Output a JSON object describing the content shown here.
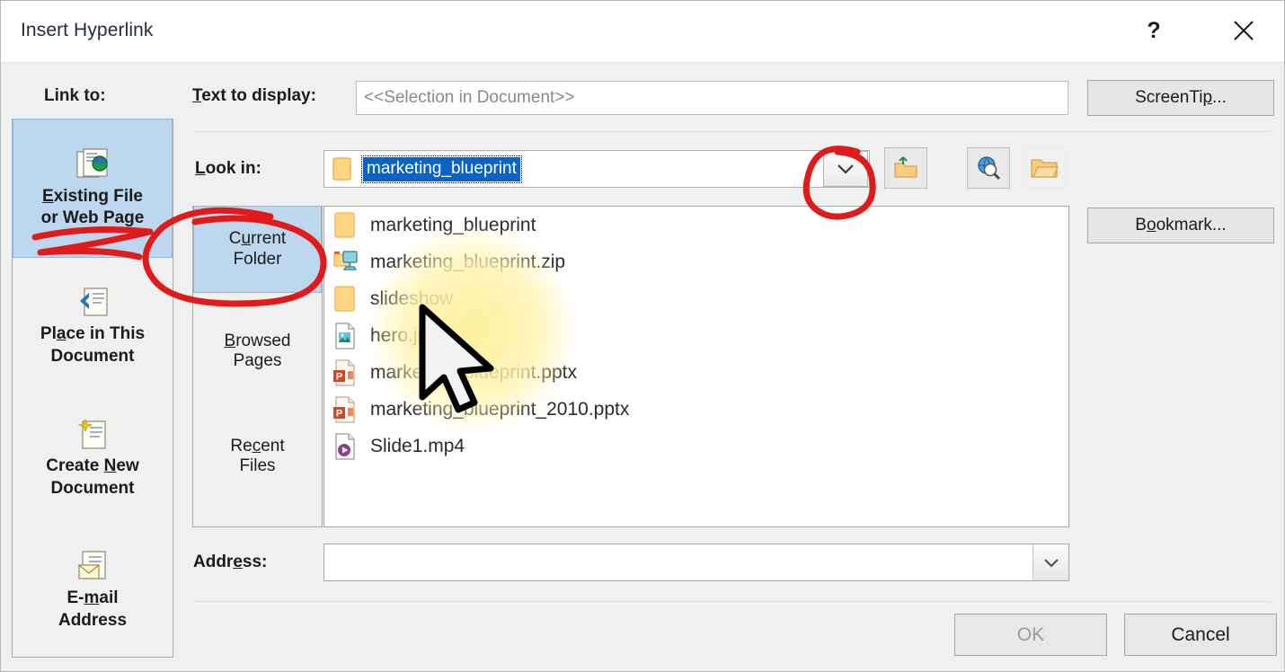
{
  "window": {
    "title": "Insert Hyperlink",
    "help_label": "?",
    "close_label": "✕"
  },
  "link_to": {
    "label": "Link to:",
    "items": [
      {
        "id": "existing-file-or-web-page",
        "line1": "Existing File",
        "line2": "or Web Page",
        "icon": "existing-file-icon",
        "selected": true
      },
      {
        "id": "place-in-this-document",
        "line1": "Place in This",
        "line2": "Document",
        "icon": "place-in-document-icon",
        "selected": false
      },
      {
        "id": "create-new-document",
        "line1": "Create New",
        "line2": "Document",
        "icon": "create-new-document-icon",
        "selected": false
      },
      {
        "id": "email-address",
        "line1": "E-mail",
        "line2": "Address",
        "icon": "email-address-icon",
        "selected": false
      }
    ]
  },
  "text_to_display": {
    "label": "Text to display:",
    "value": "<<Selection in Document>>",
    "placeholder": "<<Selection in Document>>"
  },
  "look_in": {
    "label": "Look in:",
    "value": "marketing_blueprint",
    "folder_icon": "folder-icon",
    "dropdown_icon": "chevron-down-icon",
    "tools": [
      {
        "id": "up-one-folder",
        "icon": "up-one-folder-icon"
      },
      {
        "id": "browse-the-web",
        "icon": "browse-web-icon"
      },
      {
        "id": "browse-for-file",
        "icon": "browse-file-icon"
      }
    ]
  },
  "browse_tabs": [
    {
      "id": "current-folder",
      "line1": "Current",
      "line2": "Folder",
      "accel": "u",
      "selected": true
    },
    {
      "id": "browsed-pages",
      "line1": "Browsed",
      "line2": "Pages",
      "accel": "B",
      "selected": false
    },
    {
      "id": "recent-files",
      "line1": "Recent",
      "line2": "Files",
      "accel": "c",
      "selected": false
    }
  ],
  "file_list": [
    {
      "name": "marketing_blueprint",
      "icon": "folder-icon"
    },
    {
      "name": "marketing_blueprint.zip",
      "icon": "zip-network-icon"
    },
    {
      "name": "slideshow",
      "icon": "folder-icon"
    },
    {
      "name": "hero.jpg",
      "icon": "image-file-icon"
    },
    {
      "name": "marketing_blueprint.pptx",
      "icon": "powerpoint-file-icon"
    },
    {
      "name": "marketing_blueprint_2010.pptx",
      "icon": "powerpoint-file-icon"
    },
    {
      "name": "Slide1.mp4",
      "icon": "video-file-icon"
    }
  ],
  "address": {
    "label": "Address:",
    "value": "",
    "dropdown_icon": "chevron-down-icon"
  },
  "buttons": {
    "screentip": "ScreenTip...",
    "bookmark": "Bookmark...",
    "ok": "OK",
    "cancel": "Cancel"
  },
  "colors": {
    "selection_blue": "#bdd7ee",
    "highlight_blue": "#0b63c5",
    "annotation_red": "#e01b1b",
    "dialog_bg": "#f0f0f0",
    "glow_yellow": "#ffef96"
  },
  "annotations": [
    {
      "id": "underline-existing-file",
      "shape": "squiggle"
    },
    {
      "id": "circle-current-folder",
      "shape": "ellipse"
    },
    {
      "id": "circle-lookin-dropdown",
      "shape": "ellipse"
    }
  ]
}
